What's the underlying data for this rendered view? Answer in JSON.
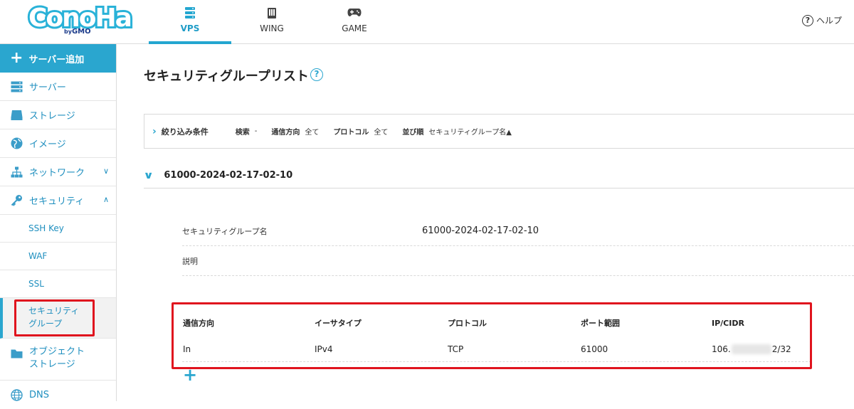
{
  "header": {
    "logo": "ConoHa by GMO",
    "tabs": [
      {
        "label": "VPS",
        "icon": "server-stack-icon",
        "active": true
      },
      {
        "label": "WING",
        "icon": "building-icon",
        "active": false
      },
      {
        "label": "GAME",
        "icon": "gamepad-icon",
        "active": false
      }
    ],
    "help_label": "ヘルプ",
    "help_icon": "?"
  },
  "sidebar": {
    "add_server": "サーバー追加",
    "items": [
      {
        "label": "サーバー",
        "icon": "server-icon"
      },
      {
        "label": "ストレージ",
        "icon": "disk-icon"
      },
      {
        "label": "イメージ",
        "icon": "globe-disc-icon"
      },
      {
        "label": "ネットワーク",
        "icon": "network-icon",
        "chevron": "down"
      },
      {
        "label": "セキュリティ",
        "icon": "key-icon",
        "chevron": "up"
      }
    ],
    "security_sub": [
      {
        "label": "SSH Key"
      },
      {
        "label": "WAF"
      },
      {
        "label": "SSL"
      },
      {
        "label_line1": "セキュリティ",
        "label_line2": "グループ",
        "active": true
      }
    ],
    "bottom_items": [
      {
        "label_line1": "オブジェクト",
        "label_line2": "ストレージ",
        "icon": "folder-icon"
      },
      {
        "label": "DNS",
        "icon": "globe-icon"
      }
    ]
  },
  "main": {
    "title": "セキュリティグループリスト",
    "title_help": "?",
    "filter": {
      "title": "絞り込み条件",
      "search_key": "検索",
      "search_val": "-",
      "direction_key": "通信方向",
      "direction_val": "全て",
      "protocol_key": "プロトコル",
      "protocol_val": "全て",
      "sort_key": "並び順",
      "sort_val": "セキュリティグループ名▲"
    },
    "group": {
      "name": "61000-2024-02-17-02-10",
      "name_label": "セキュリティグループ名",
      "name_value": "61000-2024-02-17-02-10",
      "desc_label": "説明",
      "desc_value": ""
    },
    "rules": {
      "columns": [
        "通信方向",
        "イーサタイプ",
        "プロトコル",
        "ポート範囲",
        "IP/CIDR"
      ],
      "rows": [
        {
          "direction": "In",
          "ethertype": "IPv4",
          "protocol": "TCP",
          "port": "61000",
          "ip_prefix": "106.",
          "ip_suffix": "2/32"
        }
      ]
    },
    "add_rule": "+"
  },
  "colors": {
    "accent": "#2aa6cf",
    "highlight": "#e0141e"
  }
}
